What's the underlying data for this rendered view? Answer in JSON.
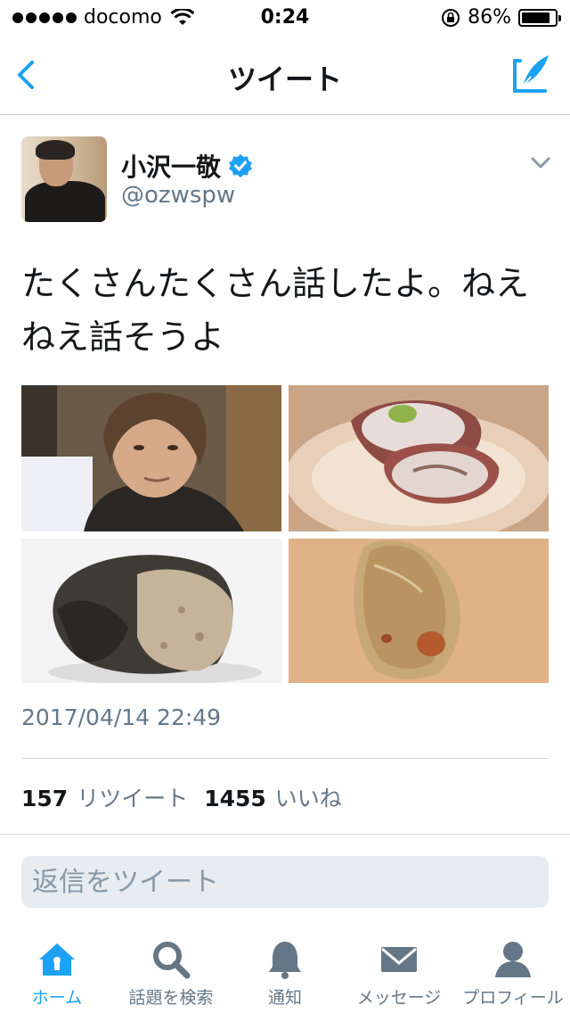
{
  "status_bar": {
    "carrier": "docomo",
    "time": "0:24",
    "battery": "86%",
    "battery_level": 0.86
  },
  "nav": {
    "title": "ツイート"
  },
  "tweet": {
    "user_name": "小沢一敬",
    "handle": "@ozwspw",
    "text": "たくさんたくさん話したよ。ねえねえ話そうよ",
    "date": "2017/04/14 22:49",
    "retweets": "157",
    "retweets_label": "リツイート",
    "likes": "1455",
    "likes_label": "いいね"
  },
  "reply": {
    "placeholder": "返信をツイート"
  },
  "tabbar": {
    "items": [
      {
        "label": "ホーム",
        "icon": "home-icon",
        "active": true
      },
      {
        "label": "話題を検索",
        "icon": "search-icon"
      },
      {
        "label": "通知",
        "icon": "bell-icon"
      },
      {
        "label": "メッセージ",
        "icon": "envelope-icon"
      },
      {
        "label": "プロフィール",
        "icon": "person-icon"
      }
    ]
  },
  "colors": {
    "accent": "#1da1f2",
    "secondary_text": "#657786",
    "divider": "#d4d8dc"
  }
}
